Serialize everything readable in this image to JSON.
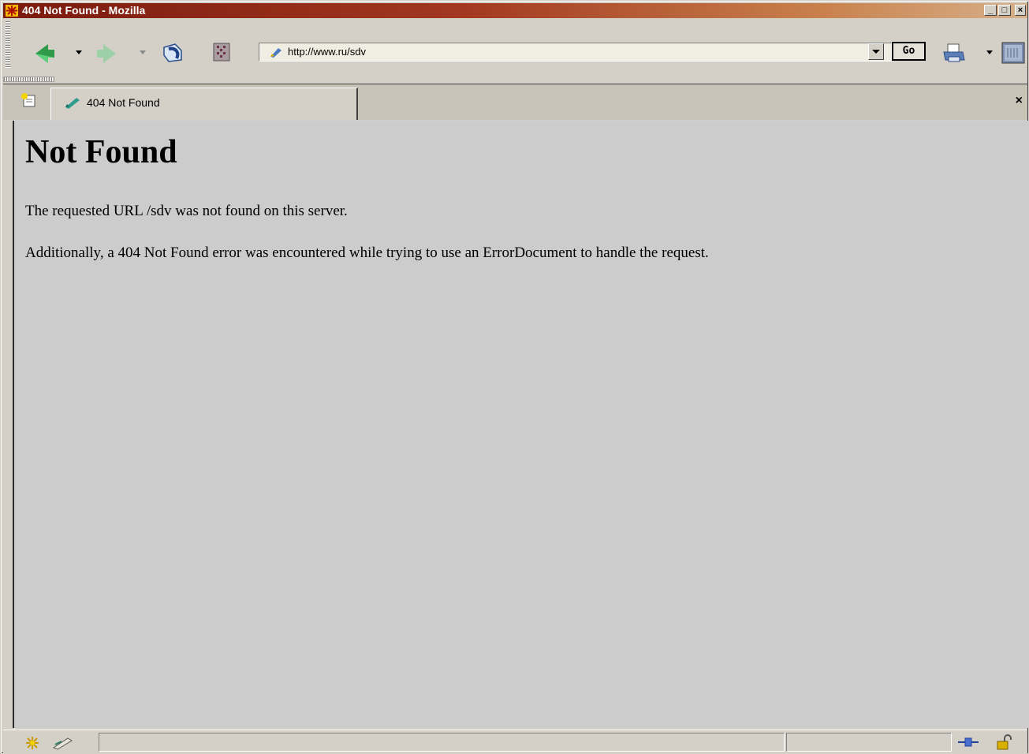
{
  "window": {
    "title": "404 Not Found - Mozilla",
    "controls": [
      "_",
      "□",
      "×"
    ]
  },
  "navbar": {
    "back_icon": "back-arrow-icon",
    "forward_icon": "forward-arrow-icon",
    "reload_icon": "reload-icon",
    "stop_icon": "stop-icon",
    "url": "http://www.ru/sdv",
    "go_label": "Go",
    "print_icon": "print-icon",
    "throbber_icon": "mozilla-throbber-icon"
  },
  "tabs": {
    "new_tab_icon": "new-tab-icon",
    "items": [
      {
        "label": "404 Not Found",
        "icon": "page-loaded-icon"
      }
    ],
    "close_label": "×"
  },
  "content": {
    "heading": "Not Found",
    "paragraph1": "The requested URL /sdv was not found on this server.",
    "paragraph2": "Additionally, a 404 Not Found error was encountered while trying to use an ErrorDocument to handle the request."
  },
  "statusbar": {
    "left_icons": [
      "navigator-icon",
      "mail-icon"
    ],
    "right_icons": [
      "connection-icon",
      "security-lock-icon"
    ]
  },
  "colors": {
    "titlebar_start": "#7a1a0e",
    "titlebar_end": "#d7b08a",
    "chrome": "#d4d0c8",
    "content_bg": "#cccccc"
  }
}
